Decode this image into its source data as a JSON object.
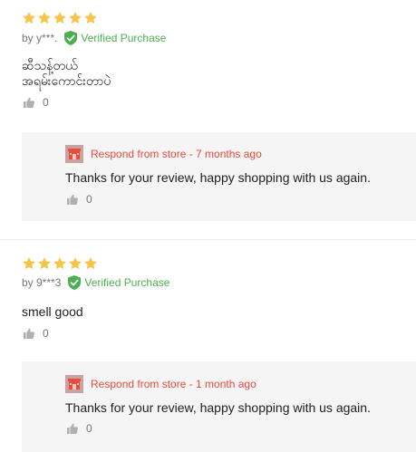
{
  "reviews": [
    {
      "rating": 5,
      "author": "by y***.",
      "verified_label": "Verified Purchase",
      "content": "ဆီသန့်တယ်\nအရမ်းကောင်းတာပဲ",
      "likes": "0",
      "reply": {
        "header": "Respond from store - 7 months ago",
        "text": "Thanks for your review, happy shopping with us again.",
        "likes": "0"
      }
    },
    {
      "rating": 5,
      "author": "by 9***3",
      "verified_label": "Verified Purchase",
      "content": "smell good",
      "likes": "0",
      "reply": {
        "header": "Respond from store - 1 month ago",
        "text": "Thanks for your review, happy shopping with us again.",
        "likes": "0"
      }
    }
  ],
  "colors": {
    "star": "#f7c44b",
    "verified": "#4caf50",
    "store_accent": "#e74c3c",
    "reply_bg": "#f5f5f5"
  },
  "icons": {
    "star": "star-icon",
    "verified": "shield-check-icon",
    "like": "thumbs-up-icon",
    "store": "store-icon"
  }
}
